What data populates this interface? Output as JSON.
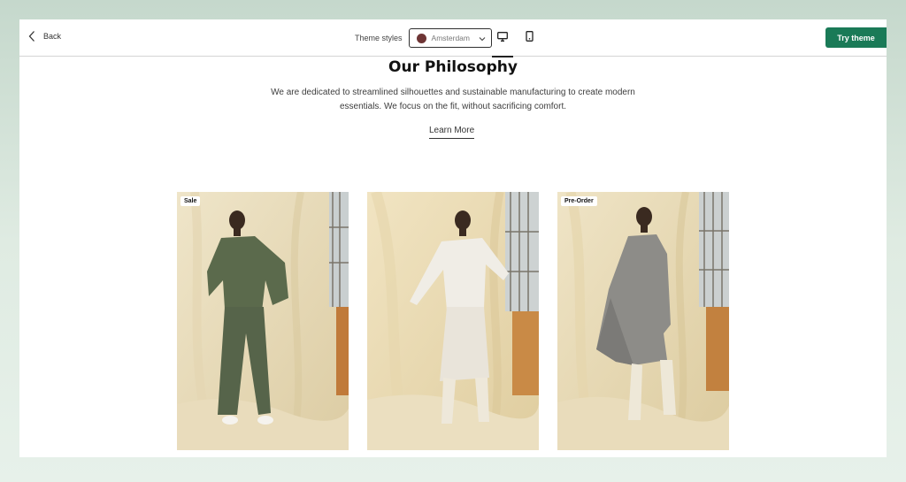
{
  "topbar": {
    "back_label": "Back",
    "theme_styles_label": "Theme styles",
    "selected_style": "Amsterdam",
    "style_swatch_color": "#6e3535",
    "try_label": "Try theme",
    "try_color": "#1a7a57"
  },
  "section": {
    "title": "Our Philosophy",
    "description": "We are dedicated to streamlined silhouettes and sustainable manufacturing to create modern essentials. We focus on the fit, without sacrificing comfort.",
    "link": "Learn More"
  },
  "products": [
    {
      "badge": "Sale",
      "image": "model in green tunic and trousers"
    },
    {
      "badge": "",
      "image": "model in white sweater and skirt"
    },
    {
      "badge": "Pre-Order",
      "image": "model in grey long coat"
    }
  ]
}
